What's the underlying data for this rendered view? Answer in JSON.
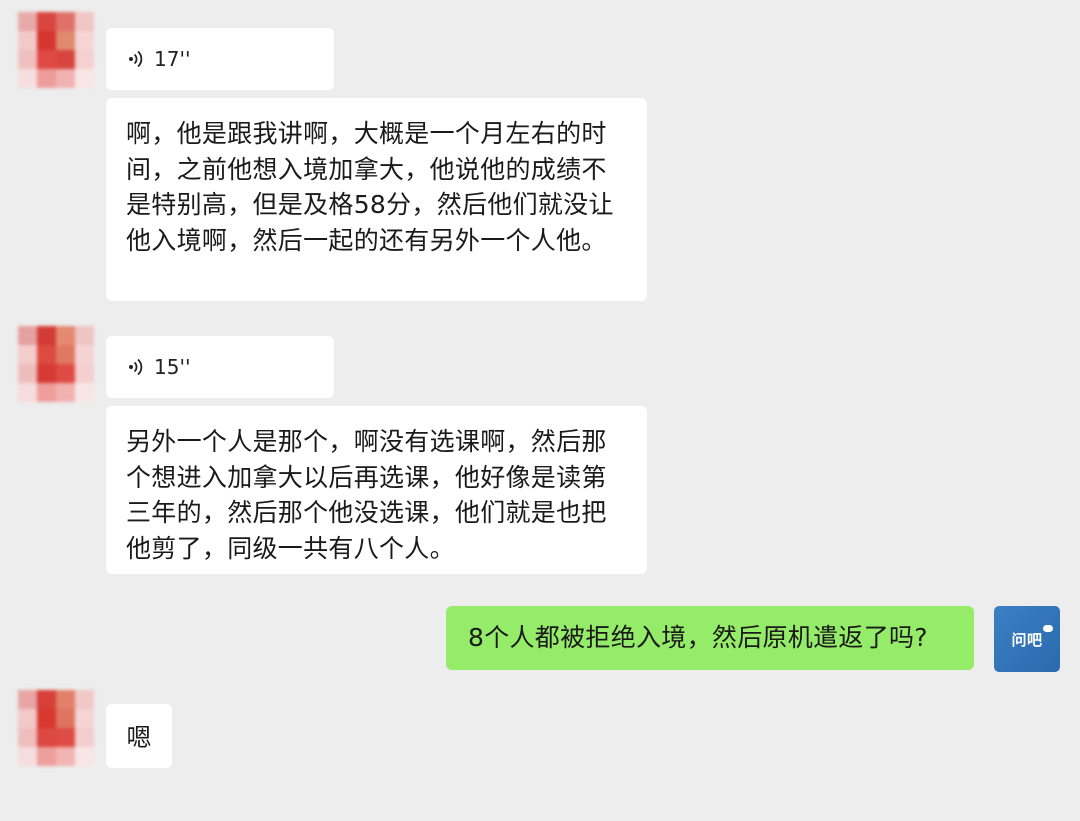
{
  "conversation": {
    "messages": [
      {
        "from": "other",
        "type": "voice",
        "duration": "17''"
      },
      {
        "from": "other",
        "type": "text",
        "text": "啊，他是跟我讲啊，大概是一个月左右的时\n间，之前他想入境加拿大，他说他的成绩不\n是特别高，但是及格58分，然后他们就没让\n他入境啊，然后一起的还有另外一个人他。"
      },
      {
        "from": "other",
        "type": "voice",
        "duration": "15''"
      },
      {
        "from": "other",
        "type": "text",
        "text": "另外一个人是那个，啊没有选课啊，然后那\n个想进入加拿大以后再选课，他好像是读第\n三年的，然后那个他没选课，他们就是也把\n他剪了，同级一共有八个人。"
      },
      {
        "from": "self",
        "type": "text",
        "text": "8个人都被拒绝入境，然后原机遣返了吗?"
      },
      {
        "from": "other",
        "type": "text",
        "text": "嗯"
      }
    ]
  },
  "self_avatar": {
    "logo_text": "问吧",
    "icon": "wenba-logo-icon",
    "color": "#2f74b9"
  },
  "colors": {
    "background": "#ededed",
    "received_bubble": "#ffffff",
    "sent_bubble": "#95ec69"
  }
}
